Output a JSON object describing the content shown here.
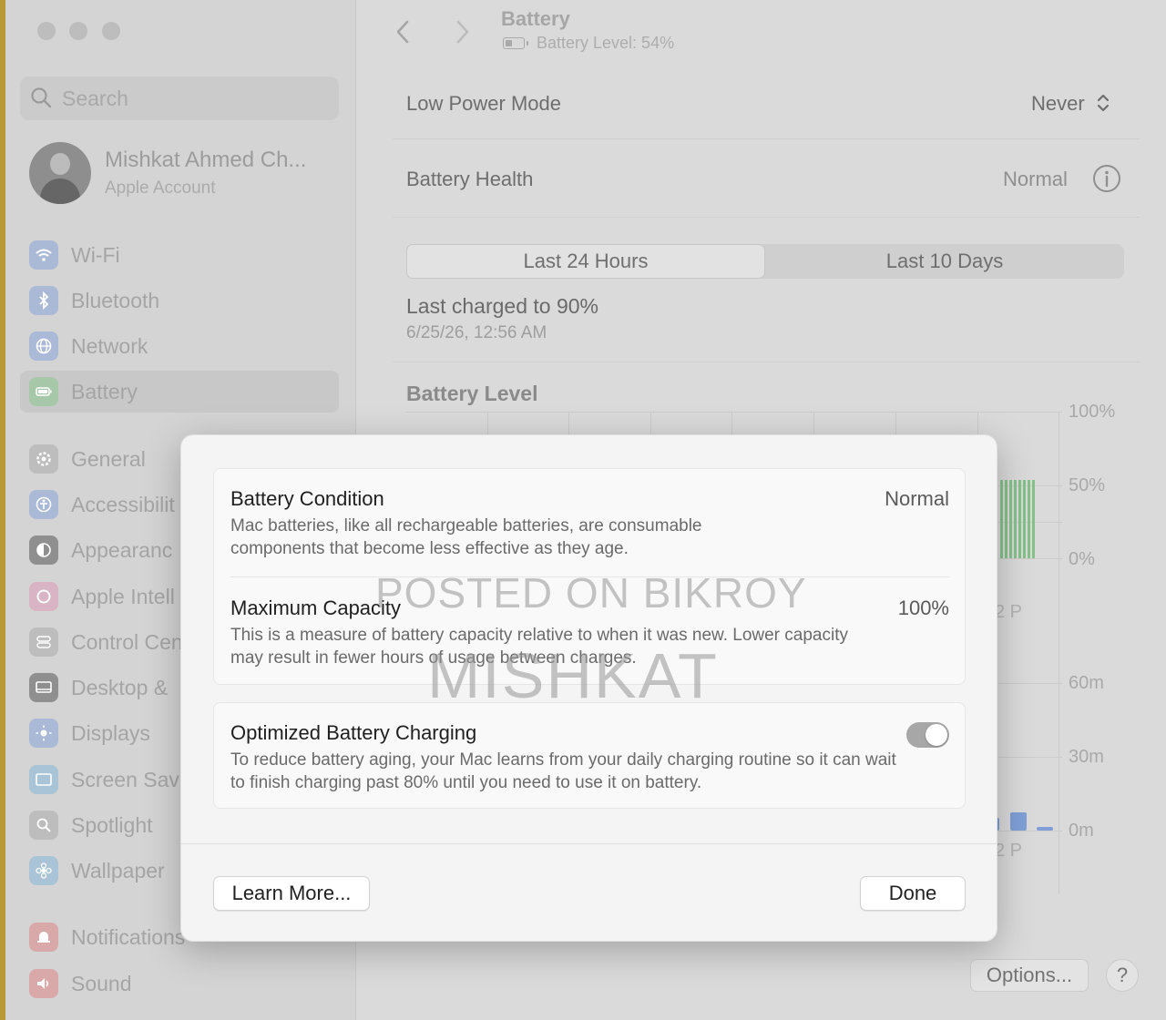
{
  "sidebar": {
    "search_placeholder": "Search",
    "account": {
      "name": "Mishkat Ahmed Ch...",
      "subtitle": "Apple Account"
    },
    "items": [
      {
        "label": "Wi-Fi",
        "icon": "wifi-icon",
        "color": "#a9b9d6"
      },
      {
        "label": "Bluetooth",
        "icon": "bluetooth-icon",
        "color": "#a9b9d6"
      },
      {
        "label": "Network",
        "icon": "globe-icon",
        "color": "#a9b9d6"
      },
      {
        "label": "Battery",
        "icon": "battery-icon",
        "color": "#a6c8a8",
        "active": true
      },
      {
        "label": "General",
        "icon": "gear-icon",
        "color": "#bdbdbd"
      },
      {
        "label": "Accessibilit",
        "icon": "accessibility-icon",
        "color": "#a9b9d6"
      },
      {
        "label": "Appearanc",
        "icon": "appearance-icon",
        "color": "#8f8f8f"
      },
      {
        "label": "Apple Intell",
        "icon": "apple-intelligence-icon",
        "color": "#d8b4c4"
      },
      {
        "label": "Control Cen",
        "icon": "control-center-icon",
        "color": "#bdbdbd"
      },
      {
        "label": "Desktop &",
        "icon": "desktop-icon",
        "color": "#8f8f8f"
      },
      {
        "label": "Displays",
        "icon": "sun-icon",
        "color": "#a9b9d6"
      },
      {
        "label": "Screen Sav",
        "icon": "screensaver-icon",
        "color": "#a9c4d6"
      },
      {
        "label": "Spotlight",
        "icon": "magnifier-icon",
        "color": "#bdbdbd"
      },
      {
        "label": "Wallpaper",
        "icon": "flower-icon",
        "color": "#a9c4d6"
      },
      {
        "label": "Notifications",
        "icon": "bell-icon",
        "color": "#d9a8a8"
      },
      {
        "label": "Sound",
        "icon": "speaker-icon",
        "color": "#d9a8a8"
      }
    ]
  },
  "main": {
    "title": "Battery",
    "subtitle": "Battery Level: 54%",
    "low_power": {
      "label": "Low Power Mode",
      "value": "Never"
    },
    "health": {
      "label": "Battery Health",
      "value": "Normal"
    },
    "tabs": [
      "Last 24 Hours",
      "Last 10 Days"
    ],
    "last_charged": {
      "title": "Last charged to 90%",
      "date": "6/25/26, 12:56 AM"
    },
    "chart_title": "Battery Level",
    "axis_level": [
      "100%",
      "50%",
      "0%"
    ],
    "axis_usage": [
      "60m",
      "30m",
      "0m"
    ],
    "x_tick_top": "2 P",
    "x_tick_bottom": "2 P",
    "options_label": "Options...",
    "help_label": "?",
    "battery_level_fraction": 0.54
  },
  "sheet": {
    "condition": {
      "title": "Battery Condition",
      "value": "Normal",
      "desc": "Mac batteries, like all rechargeable batteries, are consumable components that become less effective as they age."
    },
    "capacity": {
      "title": "Maximum Capacity",
      "value": "100%",
      "desc": "This is a measure of battery capacity relative to when it was new. Lower capacity may result in fewer hours of usage between charges."
    },
    "optimized": {
      "title": "Optimized Battery Charging",
      "desc": "To reduce battery aging, your Mac learns from your daily charging routine so it can wait to finish charging past 80% until you need to use it on battery.",
      "enabled": true
    },
    "learn_more": "Learn More...",
    "done": "Done"
  },
  "watermark": {
    "line1": "POSTED ON BIKROY",
    "line2": "MISHKAT"
  }
}
